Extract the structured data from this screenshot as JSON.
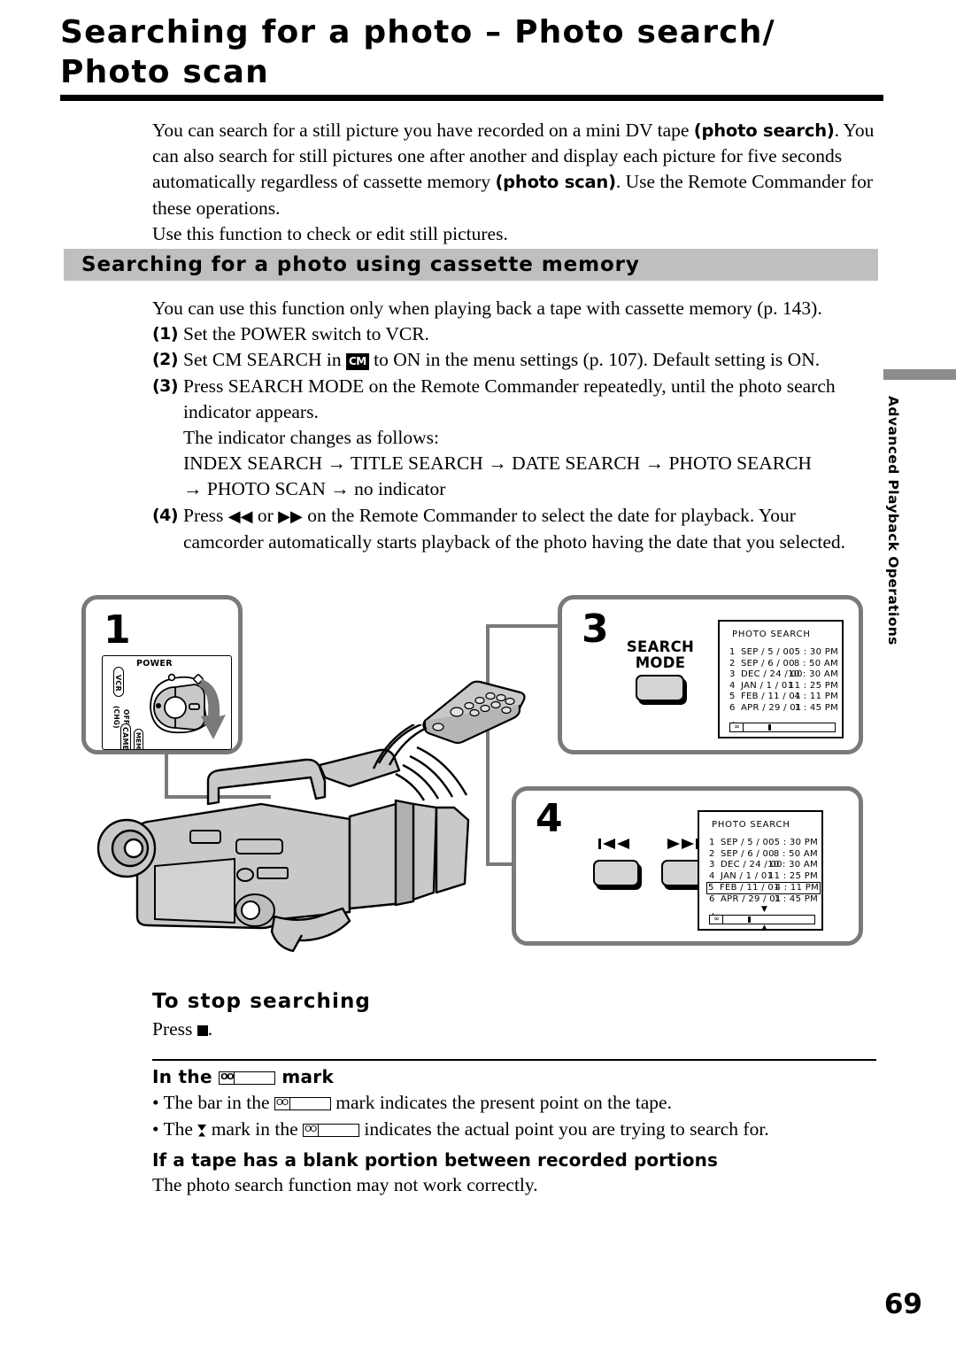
{
  "page": {
    "title_line1": "Searching for a photo – Photo search/",
    "title_line2": "Photo scan",
    "number": "69",
    "side_tab": "Advanced Playback Operations"
  },
  "intro": {
    "p1_a": "You can search for a still picture you have recorded on a mini DV tape ",
    "p1_bold1": "(photo search)",
    "p1_b": ". You can also search for still pictures one after another and display each picture for five seconds automatically regardless of cassette memory ",
    "p1_bold2": "(photo scan)",
    "p1_c": ". Use the Remote Commander for these operations.",
    "p2": "Use this function to check or edit still pictures."
  },
  "section": {
    "heading": "Searching for a photo using cassette memory",
    "lead": "You can use this function only when playing back a tape with cassette memory (p. 143).",
    "steps": [
      {
        "num": "(1)",
        "text": "Set the POWER switch to VCR."
      },
      {
        "num": "(2)",
        "text_before": "Set CM SEARCH in ",
        "icon": "CM",
        "text_after": " to ON in the menu settings (p. 107). Default setting is ON."
      },
      {
        "num": "(3)",
        "text": "Press SEARCH MODE on the Remote Commander repeatedly, until the photo search indicator appears.",
        "sub1": "The indicator changes as follows:",
        "sub2": "INDEX SEARCH → TITLE SEARCH → DATE SEARCH → PHOTO SEARCH",
        "sub3": "→ PHOTO SCAN → no indicator"
      },
      {
        "num": "(4)",
        "text_before": "Press ",
        "glyph1": "◀◀",
        "text_mid": " or ",
        "glyph2": "▶▶",
        "text_after": " on the Remote Commander to select the date for playback. Your camcorder automatically starts playback of the photo having the date that you selected."
      }
    ]
  },
  "figure": {
    "panel1": {
      "number": "1",
      "power_label": "POWER",
      "positions": [
        "VCR",
        "OFF (CHG)",
        "CAMERA",
        "MEMORY"
      ]
    },
    "panel3": {
      "number": "3",
      "button_label_line1": "SEARCH",
      "button_label_line2": "MODE"
    },
    "panel4": {
      "number": "4",
      "prev_icon": "prev-track-icon",
      "next_icon": "next-track-icon"
    },
    "screen": {
      "title": "PHOTO SEARCH",
      "rows": [
        {
          "index": "1",
          "date": "SEP /  5 / 00",
          "time": "5 : 30 PM"
        },
        {
          "index": "2",
          "date": "SEP /  6 / 00",
          "time": "8 : 50 AM"
        },
        {
          "index": "3",
          "date": "DEC / 24 / 00",
          "time": "10 : 30 AM"
        },
        {
          "index": "4",
          "date": "JAN /  1 / 01",
          "time": "11 : 25 PM"
        },
        {
          "index": "5",
          "date": "FEB / 11 / 01",
          "time": "4 : 11 PM"
        },
        {
          "index": "6",
          "date": "APR / 29 / 01",
          "time": "1 : 45 PM"
        }
      ],
      "more_indicator": "↓",
      "selected_row_index": 5
    }
  },
  "to_stop": {
    "heading": "To stop searching",
    "text_before": "Press ",
    "text_after": "."
  },
  "mark_note": {
    "head_before": "In the",
    "head_after": "mark",
    "bullet1_a": "• The bar in the",
    "bullet1_b": "mark indicates the present point on the tape.",
    "bullet2_a": "• The",
    "bullet2_b": "mark in the",
    "bullet2_c": "indicates the actual point you are trying to search for."
  },
  "blank_note": {
    "heading": "If a tape has a blank portion between recorded portions",
    "body": "The photo search function may not work correctly."
  }
}
